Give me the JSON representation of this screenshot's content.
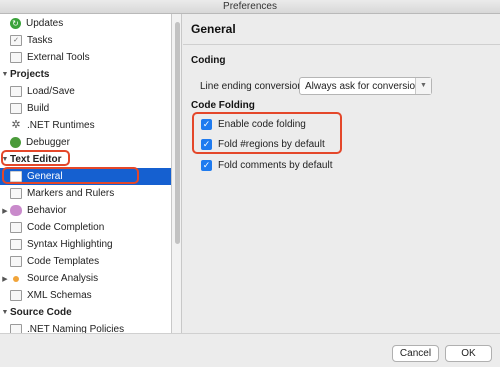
{
  "window": {
    "title": "Preferences"
  },
  "sidebar": {
    "items": [
      {
        "label": "Updates",
        "icon": "updates-icon"
      },
      {
        "label": "Tasks",
        "icon": "tasks-icon"
      },
      {
        "label": "External Tools",
        "icon": "external-tools-icon"
      },
      {
        "label": "Projects",
        "category": true
      },
      {
        "label": "Load/Save",
        "icon": "load-save-icon"
      },
      {
        "label": "Build",
        "icon": "build-icon"
      },
      {
        "label": ".NET Runtimes",
        "icon": "gear-icon"
      },
      {
        "label": "Debugger",
        "icon": "debugger-icon"
      },
      {
        "label": "Text Editor",
        "category": true
      },
      {
        "label": "General",
        "icon": "general-icon",
        "selected": true
      },
      {
        "label": "Markers and Rulers",
        "icon": "markers-icon"
      },
      {
        "label": "Behavior",
        "icon": "behavior-icon"
      },
      {
        "label": "Code Completion",
        "icon": "code-completion-icon"
      },
      {
        "label": "Syntax Highlighting",
        "icon": "syntax-highlighting-icon"
      },
      {
        "label": "Code Templates",
        "icon": "code-templates-icon"
      },
      {
        "label": "Source Analysis",
        "icon": "source-analysis-icon"
      },
      {
        "label": "XML Schemas",
        "icon": "xml-schemas-icon"
      },
      {
        "label": "Source Code",
        "category": true
      },
      {
        "label": ".NET Naming Policies",
        "icon": "naming-policies-icon"
      }
    ]
  },
  "main": {
    "title": "General",
    "coding": {
      "section_title": "Coding",
      "line_ending_label": "Line ending conversion:",
      "line_ending_value": "Always ask for conversion"
    },
    "folding": {
      "section_title": "Code Folding",
      "enable_label": "Enable code folding",
      "enable_checked": true,
      "regions_label": "Fold #regions by default",
      "regions_checked": true,
      "comments_label": "Fold comments by default",
      "comments_checked": true
    }
  },
  "footer": {
    "cancel_label": "Cancel",
    "ok_label": "OK"
  },
  "colors": {
    "selection": "#1560d0",
    "highlight": "#e4472a",
    "checkbox": "#1f7bef"
  }
}
